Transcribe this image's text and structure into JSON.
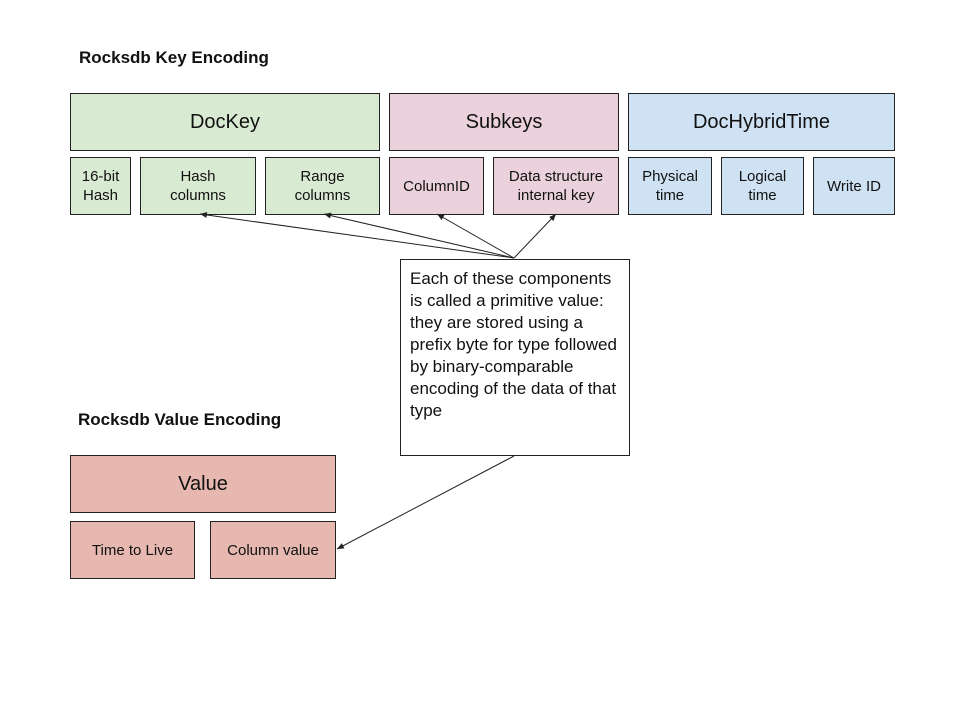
{
  "key_encoding": {
    "title": "Rocksdb Key Encoding",
    "groups": [
      {
        "label": "DocKey",
        "color": "#d9ead3",
        "parts": [
          "16-bit\nHash",
          "Hash\ncolumns",
          "Range\ncolumns"
        ]
      },
      {
        "label": "Subkeys",
        "color": "#ead1dc",
        "parts": [
          "ColumnID",
          "Data structure\ninternal key"
        ]
      },
      {
        "label": "DocHybridTime",
        "color": "#cfe2f3",
        "parts": [
          "Physical\ntime",
          "Logical\ntime",
          "Write ID"
        ]
      }
    ]
  },
  "value_encoding": {
    "title": "Rocksdb Value Encoding",
    "group": {
      "label": "Value",
      "color": "#e6b8af",
      "parts": [
        "Time to Live",
        "Column value"
      ]
    }
  },
  "note": {
    "text": "Each of these components is called a primitive value: they are stored using a prefix byte for type followed by binary-comparable encoding of the data of that type"
  },
  "arrows": [
    {
      "from": "note",
      "to": "Hash columns"
    },
    {
      "from": "note",
      "to": "Range columns"
    },
    {
      "from": "note",
      "to": "ColumnID"
    },
    {
      "from": "note",
      "to": "Data structure internal key"
    },
    {
      "from": "note",
      "to": "Column value"
    }
  ]
}
